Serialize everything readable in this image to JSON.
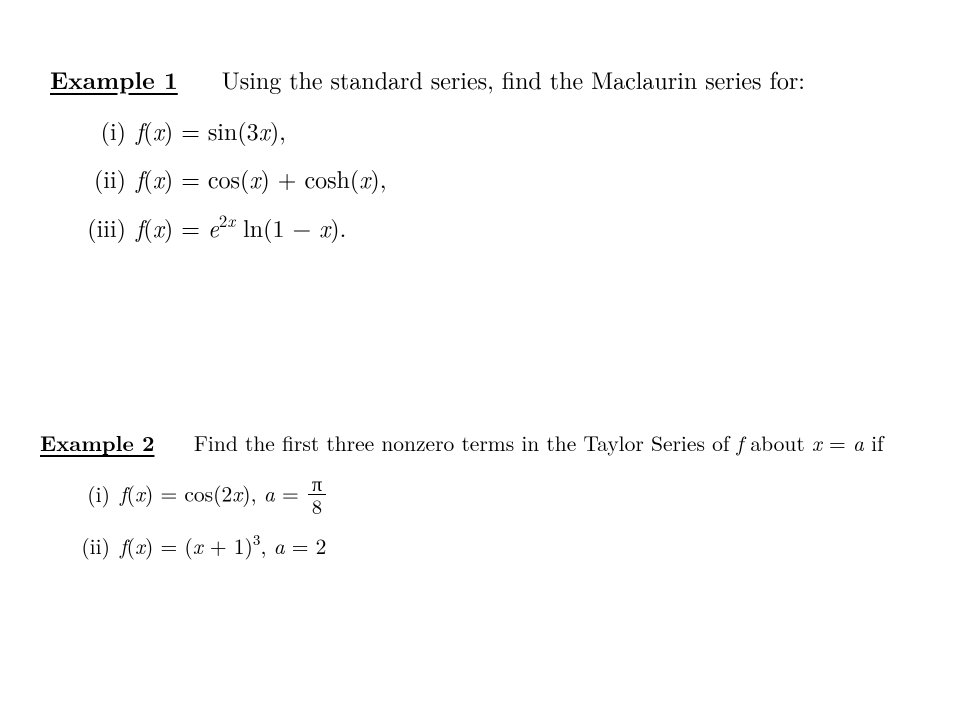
{
  "example1": {
    "label": "Example 1",
    "intro_a": "Using the standard series, find the Maclaurin series for:",
    "items": {
      "i": {
        "num": "(i)",
        "fx": "f",
        "arg": "x",
        "eq": "= sin(3",
        "x2": "x",
        "tail": "),"
      },
      "ii": {
        "num": "(ii)",
        "fx": "f",
        "arg": "x",
        "eq": "= cos(",
        "x2": "x",
        "mid": ") + cosh(",
        "x3": "x",
        "tail": "),"
      },
      "iii": {
        "num": "(iii)",
        "fx": "f",
        "arg": "x",
        "eq": "= ",
        "e": "e",
        "exp": "2x",
        "ln": " ln(1 − ",
        "x2": "x",
        "tail": ")."
      }
    }
  },
  "example2": {
    "label": "Example 2",
    "intro_a": "Find the first three nonzero terms in the Taylor Series of ",
    "intro_f": "f",
    "intro_b": " about ",
    "intro_x": "x",
    "intro_c": " = ",
    "intro_a2": "a",
    "intro_d": " if",
    "items": {
      "i": {
        "num": "(i)",
        "fx": "f",
        "arg": "x",
        "eq": "= cos(2",
        "x2": "x",
        "mid": "), ",
        "a": "a",
        "eq2": " = ",
        "frac_num": "π",
        "frac_den": "8"
      },
      "ii": {
        "num": "(ii)",
        "fx": "f",
        "arg": "x",
        "eq": "= (",
        "x2": "x",
        "mid": " + 1)",
        "exp": "3",
        "comma": ", ",
        "a": "a",
        "eq2": " = 2"
      }
    }
  }
}
